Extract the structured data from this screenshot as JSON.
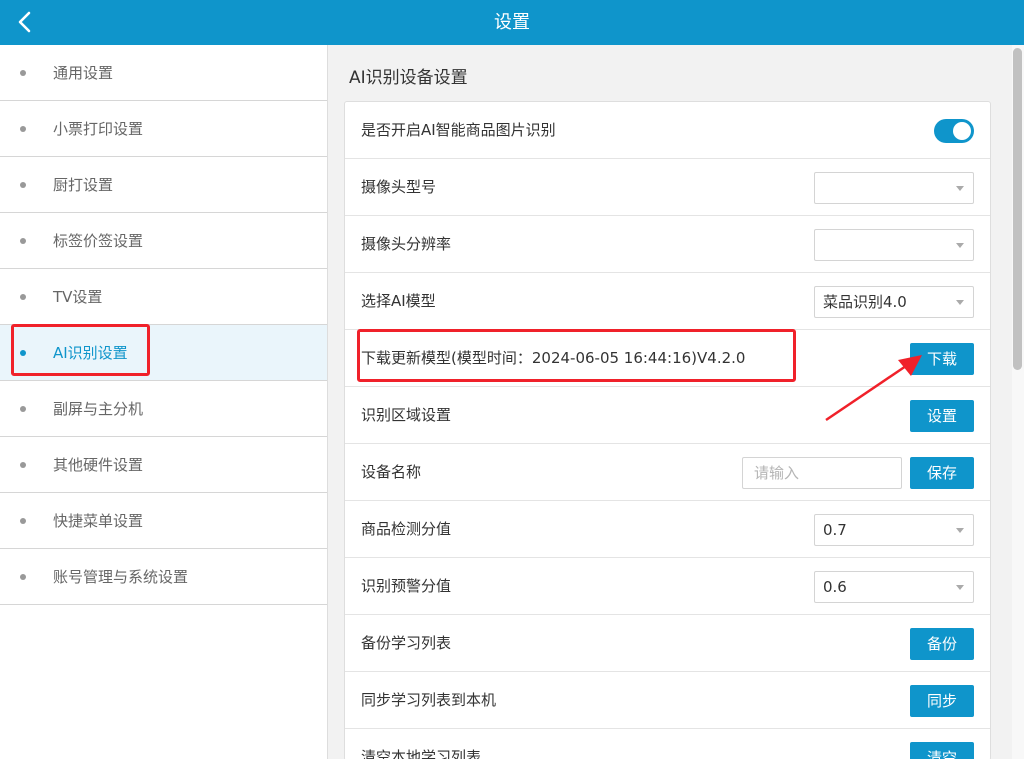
{
  "header": {
    "title": "设置",
    "back_icon": "chevron-left-icon"
  },
  "sidebar": {
    "items": [
      {
        "label": "通用设置",
        "active": false
      },
      {
        "label": "小票打印设置",
        "active": false
      },
      {
        "label": "厨打设置",
        "active": false
      },
      {
        "label": "标签价签设置",
        "active": false
      },
      {
        "label": "TV设置",
        "active": false
      },
      {
        "label": "AI识别设置",
        "active": true
      },
      {
        "label": "副屏与主分机",
        "active": false
      },
      {
        "label": "其他硬件设置",
        "active": false
      },
      {
        "label": "快捷菜单设置",
        "active": false
      },
      {
        "label": "账号管理与系统设置",
        "active": false
      }
    ]
  },
  "main": {
    "section_title": "AI识别设备设置",
    "rows": [
      {
        "label": "是否开启AI智能商品图片识别",
        "toggle_on": true
      },
      {
        "label": "摄像头型号",
        "select_value": ""
      },
      {
        "label": "摄像头分辨率",
        "select_value": ""
      },
      {
        "label": "选择AI模型",
        "select_value": "菜品识别4.0"
      },
      {
        "label": "下载更新模型(模型时间：2024-06-05 16:44:16)V4.2.0",
        "button": "下载"
      },
      {
        "label": "识别区域设置",
        "button": "设置"
      },
      {
        "label": "设备名称",
        "input_placeholder": "请输入",
        "button": "保存"
      },
      {
        "label": "商品检测分值",
        "select_value": "0.7"
      },
      {
        "label": "识别预警分值",
        "select_value": "0.6"
      },
      {
        "label": "备份学习列表",
        "button": "备份"
      },
      {
        "label": "同步学习列表到本机",
        "button": "同步"
      },
      {
        "label": "清空本地学习列表",
        "button": "清空"
      }
    ]
  },
  "colors": {
    "accent": "#0f95cb",
    "highlight": "#f0212a"
  }
}
